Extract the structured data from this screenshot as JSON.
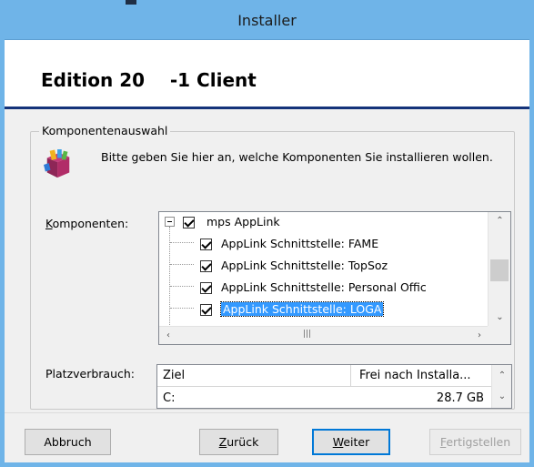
{
  "window": {
    "title": "Installer"
  },
  "header": {
    "heading": "Edition 20    -1 Client"
  },
  "group": {
    "title": "Komponentenauswahl",
    "icon": "package-icon",
    "description": "Bitte geben Sie hier an, welche Komponenten Sie installieren wollen."
  },
  "components": {
    "label_prefix": "",
    "label_access": "K",
    "label_rest": "omponenten:",
    "items": [
      {
        "label": "mps AppLink",
        "checked": true,
        "level": 0,
        "expanded": true
      },
      {
        "label": "AppLink Schnittstelle: FAME",
        "checked": true,
        "level": 1
      },
      {
        "label": "AppLink Schnittstelle: TopSoz",
        "checked": true,
        "level": 1
      },
      {
        "label": "AppLink Schnittstelle: Personal Offic",
        "checked": true,
        "level": 1
      },
      {
        "label": "AppLink Schnittstelle: LOGA",
        "checked": true,
        "level": 1,
        "selected": true
      }
    ]
  },
  "disk": {
    "label": "Platzverbrauch:",
    "columns": [
      "Ziel",
      "Frei nach Installa..."
    ],
    "rows": [
      {
        "target": "C:",
        "free": "28.7 GB"
      }
    ]
  },
  "buttons": {
    "cancel": "Abbruch",
    "back_access": "Z",
    "back_rest": "urück",
    "next_access": "W",
    "next_rest": "eiter",
    "finish_access": "F",
    "finish_rest": "ertigstellen"
  },
  "colors": {
    "accent": "#6fb4e8",
    "header_line": "#15337a",
    "selection": "#3399ff"
  }
}
